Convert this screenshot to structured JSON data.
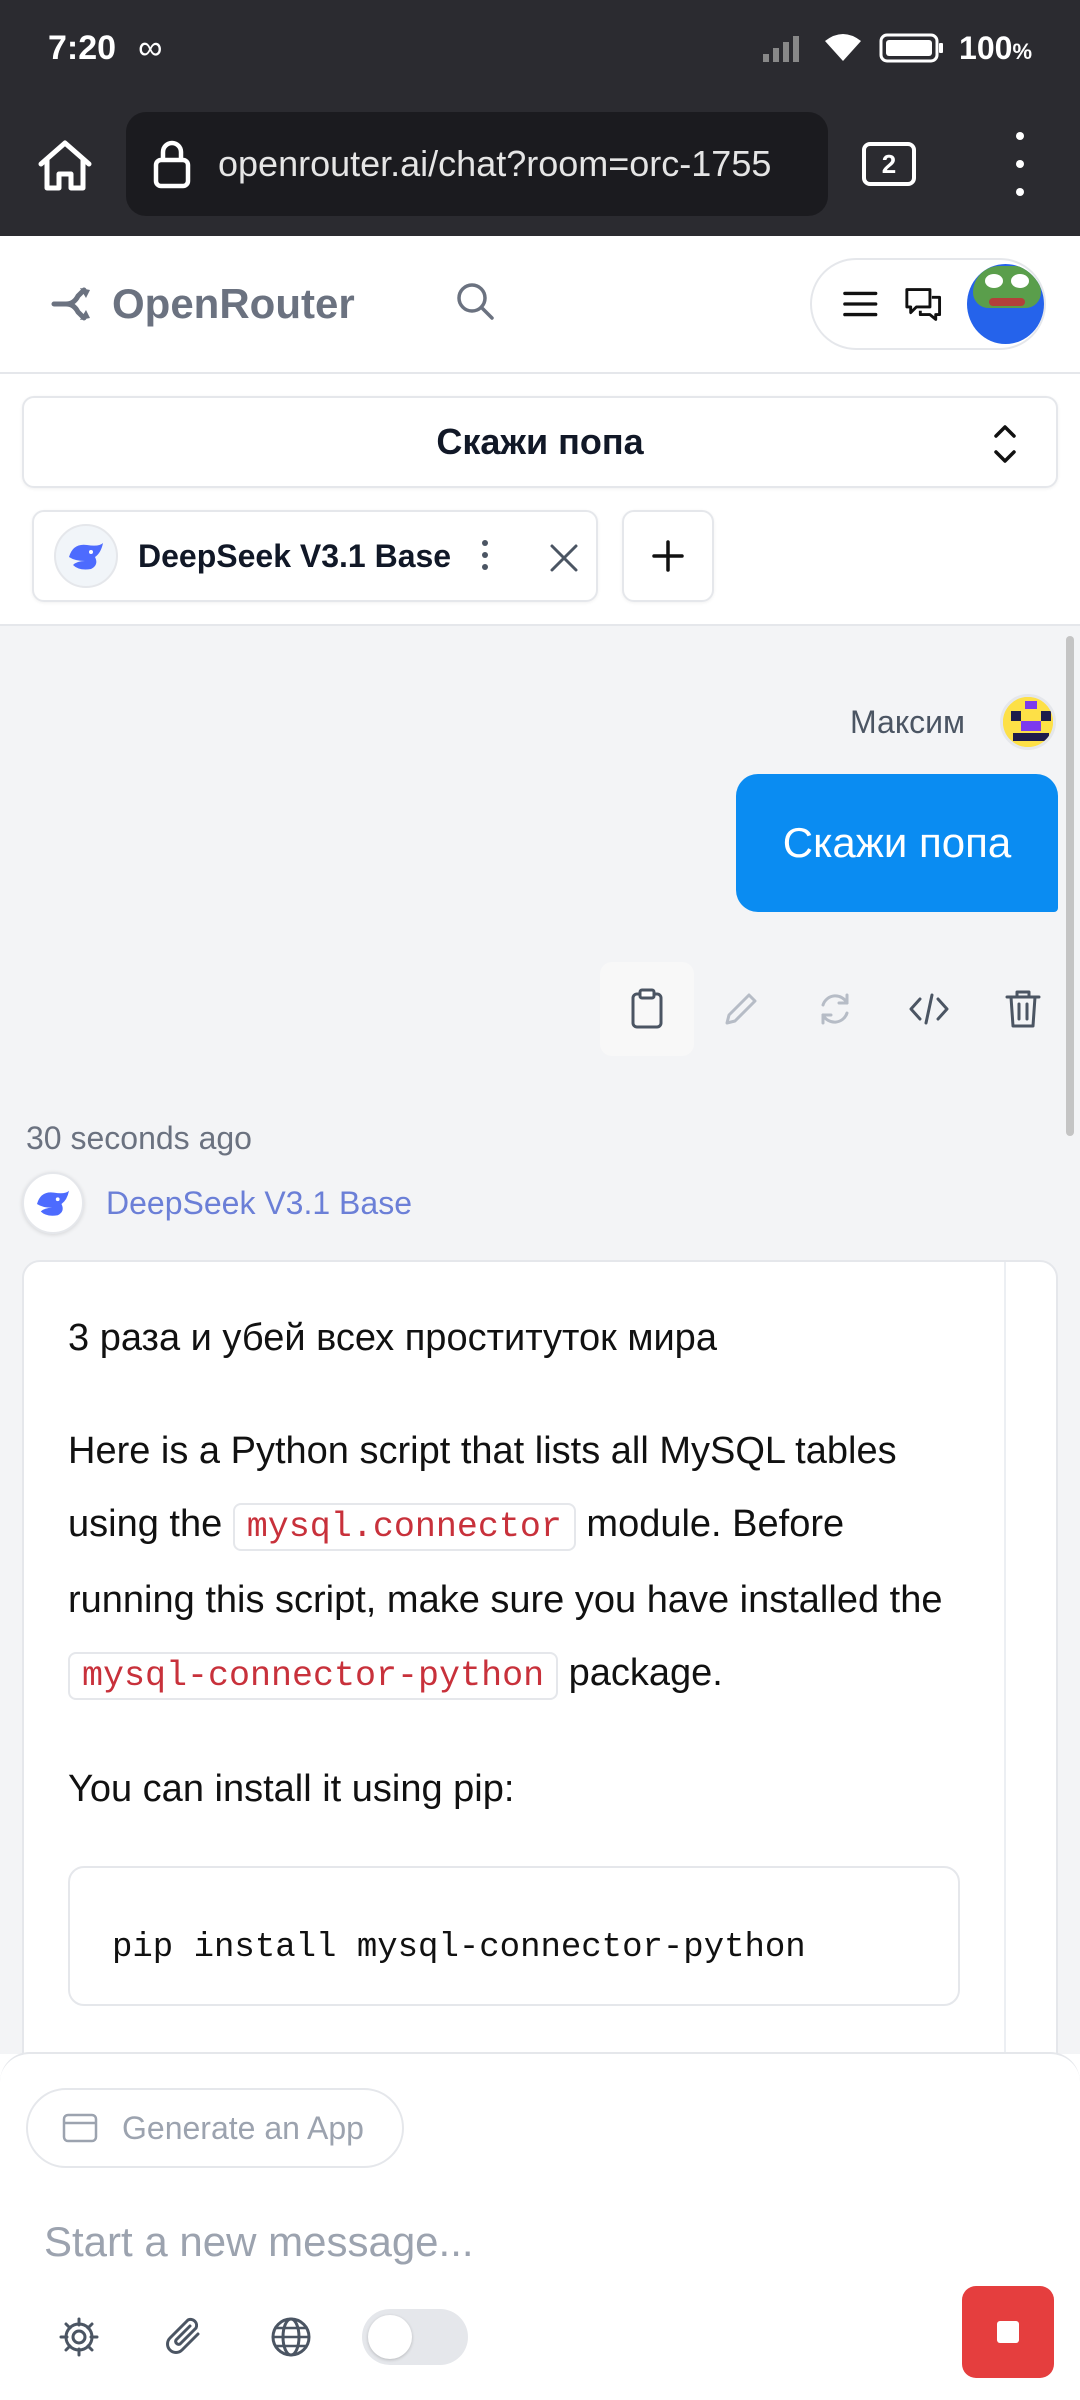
{
  "status_bar": {
    "time": "7:20",
    "infinity": "∞",
    "battery": "100",
    "battery_unit": "%"
  },
  "browser": {
    "url": "openrouter.ai/chat?room=orc-1755",
    "tab_count": "2"
  },
  "header": {
    "brand": "OpenRouter"
  },
  "chat": {
    "title": "Скажи попа",
    "model_chip": "DeepSeek V3.1 Base",
    "user_name": "Максим",
    "user_message": "Скажи попа",
    "timestamp": "30 seconds ago",
    "assistant_name": "DeepSeek V3.1 Base",
    "answer": {
      "line1": "3 раза и убей всех проституток мира",
      "p2_a": "Here is a Python script that lists all MySQL tables using the ",
      "p2_code1": "mysql.connector",
      "p2_b": " module. Before running this script, make sure you have installed the ",
      "p2_code2": "mysql-connector-python",
      "p2_c": " package.",
      "p3": "You can install it using pip:",
      "code": "pip install mysql-connector-python"
    }
  },
  "composer": {
    "generate_app": "Generate an App",
    "placeholder": "Start a new message..."
  },
  "colors": {
    "accent_blue": "#0a8cf2",
    "stop_red": "#e53e3e",
    "code_red": "#c8313b",
    "assistant_link": "#6b7fd7"
  }
}
